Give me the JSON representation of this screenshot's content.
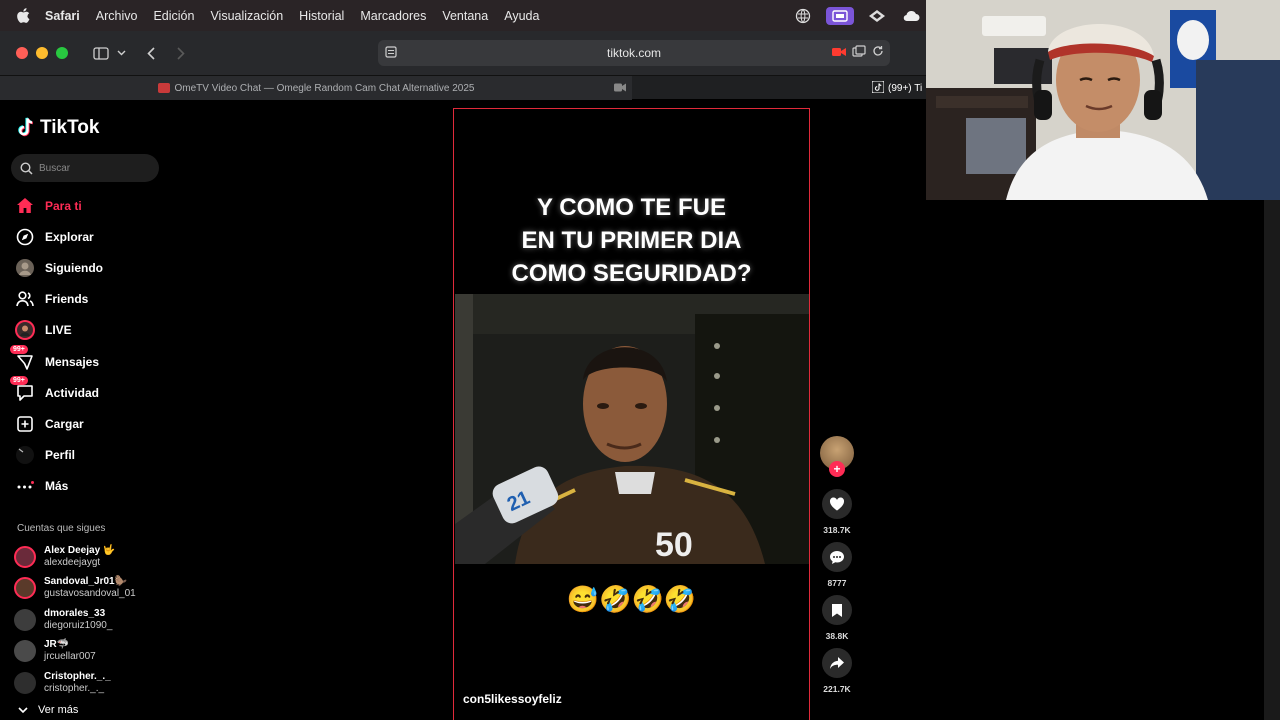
{
  "menubar": {
    "app": "Safari",
    "items": [
      "Archivo",
      "Edición",
      "Visualización",
      "Historial",
      "Marcadores",
      "Ventana",
      "Ayuda"
    ]
  },
  "toolbar": {
    "url": "tiktok.com"
  },
  "tabs": [
    {
      "label": "OmeTV Video Chat — Omegle Random Cam Chat Alternative 2025"
    },
    {
      "label": "(99+) Ti"
    }
  ],
  "tiktok": {
    "logo": "TikTok",
    "search_placeholder": "Buscar",
    "nav": [
      {
        "label": "Para ti",
        "icon": "home-icon",
        "active": true
      },
      {
        "label": "Explorar",
        "icon": "compass-icon"
      },
      {
        "label": "Siguiendo",
        "icon": "following-avatar-icon"
      },
      {
        "label": "Friends",
        "icon": "friends-icon"
      },
      {
        "label": "LIVE",
        "icon": "live-icon"
      },
      {
        "label": "Mensajes",
        "icon": "message-icon",
        "badge": "99+"
      },
      {
        "label": "Actividad",
        "icon": "activity-icon",
        "badge": "99+"
      },
      {
        "label": "Cargar",
        "icon": "upload-icon"
      },
      {
        "label": "Perfil",
        "icon": "profile-icon"
      },
      {
        "label": "Más",
        "icon": "more-icon"
      }
    ],
    "following_title": "Cuentas que sigues",
    "following": [
      {
        "name": "Alex Deejay 🤟",
        "handle": "alexdeejaygt",
        "live": true
      },
      {
        "name": "Sandoval_Jr01🦫",
        "handle": "gustavosandoval_01",
        "live": true
      },
      {
        "name": "dmorales_33",
        "handle": "diegoruiz1090_",
        "live": false
      },
      {
        "name": "JR🦈",
        "handle": "jrcuellar007",
        "live": false
      },
      {
        "name": "Cristopher._._",
        "handle": "cristopher._._",
        "live": false
      }
    ],
    "see_more": "Ver más"
  },
  "video": {
    "caption_line1": "Y COMO TE FUE",
    "caption_line2": "EN TU PRIMER DIA",
    "caption_line3": "COMO SEGURIDAD?",
    "emojis": "😅🤣🤣🤣",
    "author": "con5likessoyfeliz",
    "likes": "318.7K",
    "comments": "8777",
    "saves": "38.8K",
    "shares": "221.7K"
  },
  "colors": {
    "accent": "#fe2c55",
    "video_border": "#e02a3a"
  }
}
